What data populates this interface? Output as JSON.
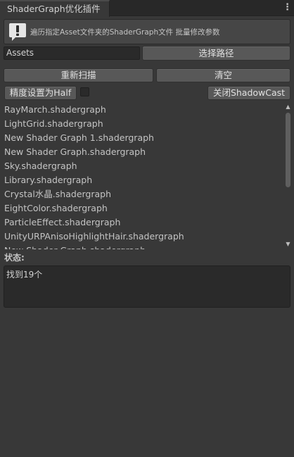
{
  "window": {
    "tab_title": "ShaderGraph优化插件",
    "menu_icon": "kebab-menu-icon"
  },
  "help": {
    "icon": "info-exclamation-icon",
    "message": "遍历指定Asset文件夹的ShaderGraph文件 批量修改参数"
  },
  "path": {
    "value": "Assets",
    "select_button": "选择路径"
  },
  "actions": {
    "rescan": "重新扫描",
    "clear": "清空",
    "precision_half": "精度设置为Half",
    "precision_toggle_checked": false,
    "disable_shadowcast": "关闭ShadowCast"
  },
  "files": [
    "RayMarch.shadergraph",
    "LightGrid.shadergraph",
    "New Shader Graph 1.shadergraph",
    "New Shader Graph.shadergraph",
    "Sky.shadergraph",
    "Library.shadergraph",
    "Crystal水晶.shadergraph",
    "EightColor.shadergraph",
    "ParticleEffect.shadergraph",
    "UnityURPAnisoHighlightHair.shadergraph",
    "New Shader Graph.shadergraph"
  ],
  "scroll": {
    "up_icon": "▲",
    "down_icon": "▼"
  },
  "status": {
    "label": "状态:",
    "text": "找到19个"
  }
}
